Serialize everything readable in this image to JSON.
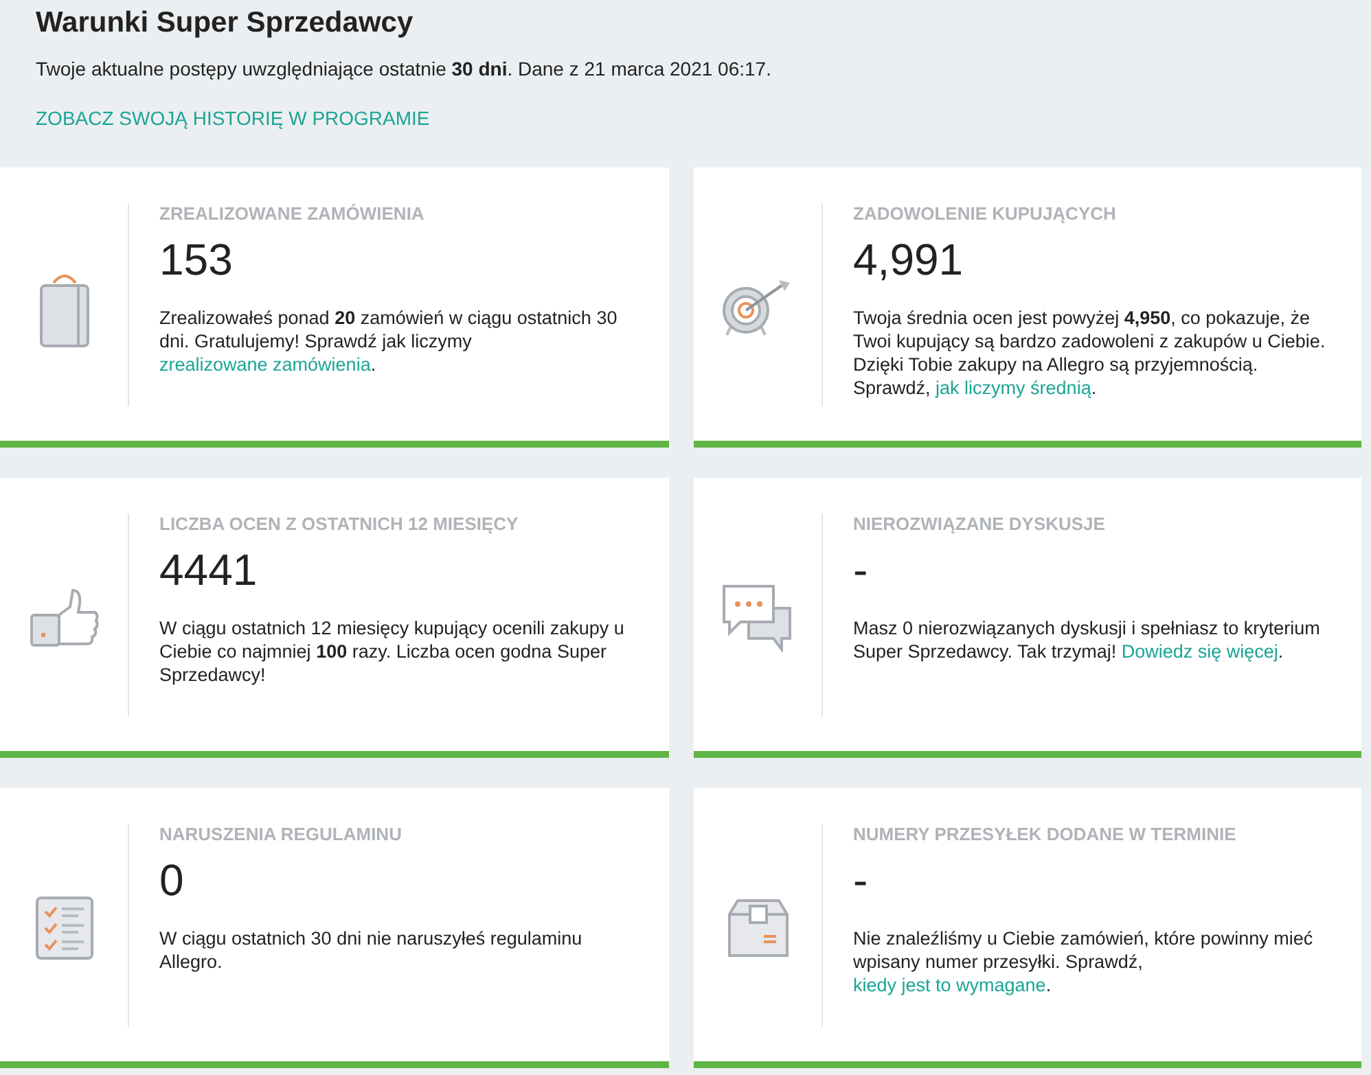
{
  "title": "Warunki Super Sprzedawcy",
  "subtitle": "Twoje aktualne postępy uwzględniające ostatnie **30 dni**. Dane z 21 marca 2021 06:17.",
  "history_link": "ZOBACZ SWOJĄ HISTORIĘ W PROGRAMIE",
  "cards": [
    {
      "kind": "bag",
      "label": "ZREALIZOWANE ZAMÓWIENIA",
      "value": "153",
      "text": "Zrealizowałeś ponad **20** zamówień w ciągu ostatnich 30 dni. Gratulujemy! Sprawdź jak liczymy",
      "link": "zrealizowane zamówienia",
      "after": ".",
      "met": true
    },
    {
      "kind": "target",
      "label": "ZADOWOLENIE KUPUJĄCYCH",
      "value": "4,991",
      "text": "Twoja średnia ocen jest powyżej **4,950**, co pokazuje, że Twoi kupujący są bardzo zadowoleni z zakupów u Ciebie. Dzięki Tobie zakupy na Allegro są przyjemnością. Sprawdź,",
      "link": "jak liczymy średnią",
      "after": ".",
      "met": true
    },
    {
      "kind": "thumb",
      "label": "LICZBA OCEN Z OSTATNICH 12 MIESIĘCY",
      "value": "4441",
      "text": "W ciągu ostatnich 12 miesięcy kupujący ocenili zakupy u Ciebie co najmniej **100** razy. Liczba ocen godna Super Sprzedawcy!",
      "met": true
    },
    {
      "kind": "chat",
      "label": "NIEROZWIĄZANE DYSKUSJE",
      "value": "-",
      "text": "Masz 0 nierozwiązanych dyskusji i spełniasz to kryterium Super Sprzedawcy. Tak trzymaj!",
      "link": "Dowiedz się więcej",
      "after": ".",
      "met": true
    },
    {
      "kind": "checklist",
      "label": "NARUSZENIA REGULAMINU",
      "value": "0",
      "text": "W ciągu ostatnich 30 dni nie naruszyłeś regulaminu Allegro.",
      "met": true
    },
    {
      "kind": "box",
      "label": "NUMERY PRZESYŁEK DODANE W TERMINIE",
      "value": "-",
      "text": "Nie znaleźliśmy u Ciebie zamówień, które powinny mieć wpisany numer przesyłki. Sprawdź,",
      "link": "kiedy jest to wymagane",
      "after": ".",
      "met": true
    }
  ]
}
